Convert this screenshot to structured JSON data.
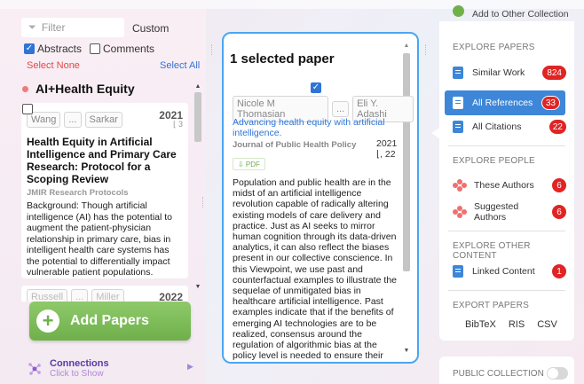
{
  "left": {
    "filter_placeholder": "Filter",
    "custom_label": "Custom",
    "abstracts_label": "Abstracts",
    "abstracts_checked": true,
    "comments_label": "Comments",
    "comments_checked": false,
    "select_none": "Select None",
    "select_all": "Select All",
    "group_title": "AI+Health Equity",
    "card": {
      "author_first": "Wang",
      "ellipsis": "...",
      "author_last": "Sarkar",
      "year": "2021",
      "citations": "⌊ 3",
      "title": "Health Equity in Artificial Intelligence and Primary Care Research: Protocol for a Scoping Review",
      "journal": "JMIR Research Protocols",
      "abstract": "Background: Though artificial intelligence (AI) has the potential to augment the patient-physician relationship in primary care, bias in intelligent health care systems has the potential to differentially impact vulnerable patient populations. Objective: The purpose of this scoping review is to summ"
    },
    "card2": {
      "author_first": "Russell",
      "ellipsis": "...",
      "author_last": "Miller",
      "year": "2022"
    },
    "add_papers": "Add Papers",
    "connections_title": "Connections",
    "connections_sub": "Click to Show"
  },
  "center": {
    "title": "1 selected paper",
    "author_first": "Nicole M Thomasian",
    "ellipsis": "...",
    "author_last": "Eli Y. Adashi",
    "link_title": "Advancing health equity with artificial intelligence.",
    "journal": "Journal of Public Health Policy",
    "year": "2021",
    "citations": "⌊, 22",
    "pdf_label": "⇩ PDF",
    "abstract": "Population and public health are in the midst of an artificial intelligence revolution capable of radically altering existing models of care delivery and practice. Just as AI seeks to mirror human cognition through its data-driven analytics, it can also reflect the biases present in our collective conscience. In this Viewpoint, we use past and counterfactual examples to illustrate the sequelae of unmitigated bias in healthcare artificial intelligence. Past examples indicate that if the benefits of emerging AI technologies are to be realized, consensus around the regulation of algorithmic bias at the policy level is needed to ensure their ethical integration into the health system. This paper puts forth regulatory strategies for uprooting bias in healthcare AI that can inform"
  },
  "right": {
    "add_collection": "Add to Other Collection",
    "explore_papers": "EXPLORE PAPERS",
    "similar_work": "Similar Work",
    "similar_count": "824",
    "all_references": "All References",
    "references_count": "33",
    "all_citations": "All Citations",
    "citations_count": "22",
    "explore_people": "EXPLORE PEOPLE",
    "these_authors": "These Authors",
    "these_count": "6",
    "suggested_authors": "Suggested Authors",
    "suggested_count": "6",
    "explore_other": "EXPLORE OTHER CONTENT",
    "linked_content": "Linked Content",
    "linked_count": "1",
    "export_papers": "EXPORT PAPERS",
    "bibtex": "BibTeX",
    "ris": "RIS",
    "csv": "CSV",
    "public_collection": "PUBLIC COLLECTION"
  },
  "colors": {
    "accent": "#3d86d8",
    "badge": "#e02424",
    "add_button": "#7dbd58",
    "center_border": "#4aa6f2"
  }
}
